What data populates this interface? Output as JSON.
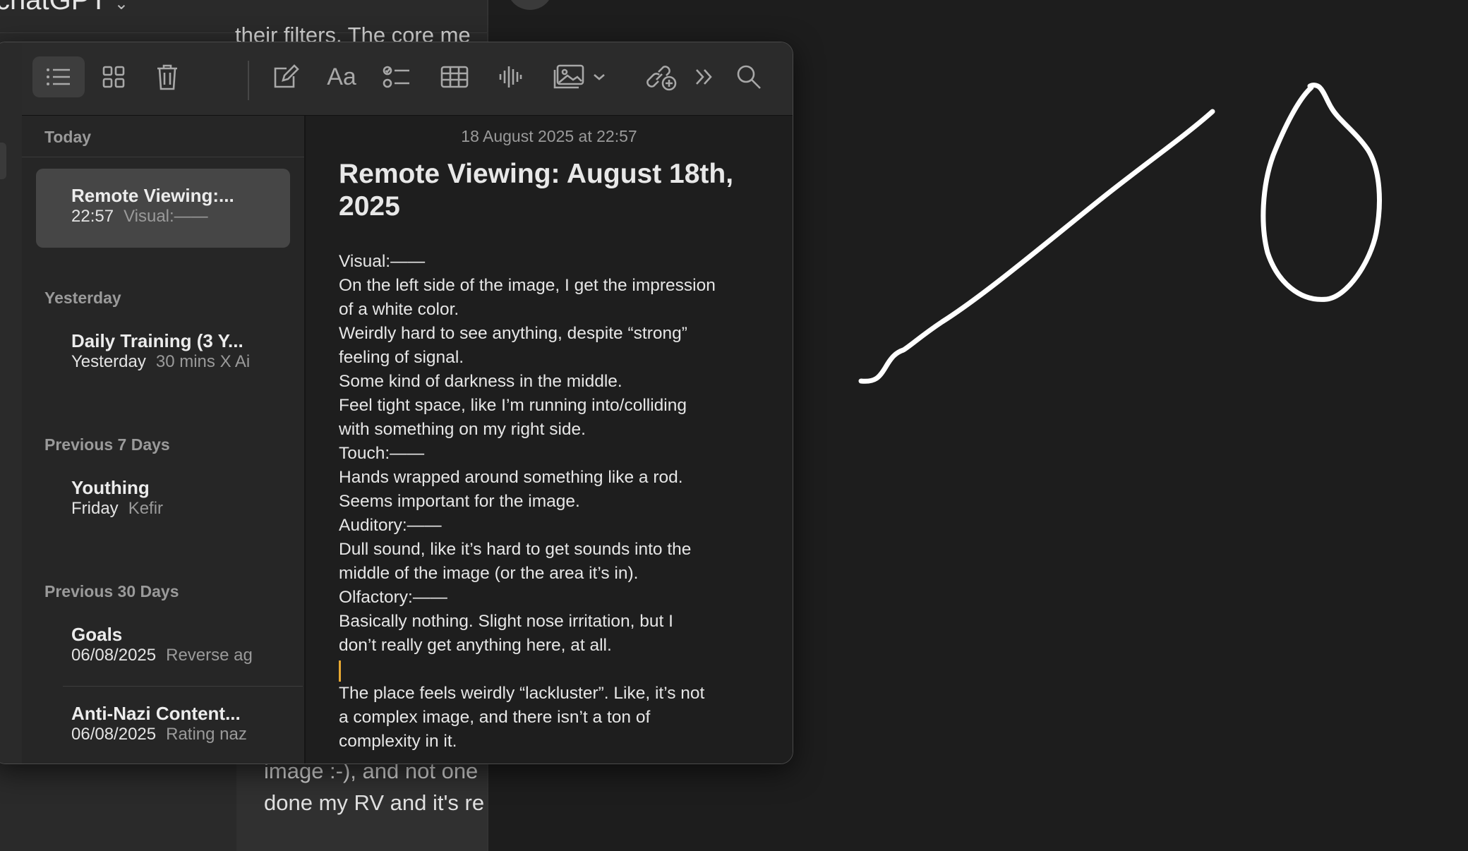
{
  "background_window": {
    "title": "chatGPT",
    "snippet_top": "their filters. The core me",
    "snippet_bottom_1": "image :-), and not one",
    "snippet_bottom_2": "done my RV and it's re"
  },
  "toolbar": {
    "icons": [
      "list-view-icon",
      "gallery-view-icon",
      "trash-icon",
      "compose-icon",
      "format-text-icon",
      "checklist-icon",
      "table-icon",
      "audio-icon",
      "media-icon",
      "chevron-down-icon",
      "collaborate-icon",
      "more-icon",
      "search-icon"
    ],
    "format_label": "Aa"
  },
  "sidebar": {
    "sections": [
      {
        "header": "Today",
        "notes": [
          {
            "title": "Remote Viewing:...",
            "time": "22:57",
            "preview": "Visual:——",
            "selected": true
          }
        ]
      },
      {
        "header": "Yesterday",
        "notes": [
          {
            "title": "Daily Training (3 Y...",
            "time": "Yesterday",
            "preview": "30 mins X Ai"
          }
        ]
      },
      {
        "header": "Previous 7 Days",
        "notes": [
          {
            "title": "Youthing",
            "time": "Friday",
            "preview": "Kefir"
          }
        ]
      },
      {
        "header": "Previous 30 Days",
        "notes": [
          {
            "title": "Goals",
            "time": "06/08/2025",
            "preview": "Reverse ag"
          },
          {
            "title": "Anti-Nazi Content...",
            "time": "06/08/2025",
            "preview": "Rating naz"
          }
        ]
      }
    ]
  },
  "editor": {
    "date": "18 August 2025 at 22:57",
    "title": "Remote Viewing: August 18th, 2025",
    "lines": [
      "Visual:——",
      "On the left side of the image, I get the impression",
      "of a white color.",
      "Weirdly hard to see anything, despite “strong”",
      "feeling of signal.",
      "Some kind of darkness in the middle.",
      "Feel tight space, like I’m running into/colliding",
      "with something on my right side.",
      "Touch:——",
      "Hands wrapped around something like a rod.",
      "Seems important for the image.",
      "Auditory:——",
      "Dull sound, like it’s hard to get sounds into the",
      "middle of the image (or the area it’s in).",
      "Olfactory:——",
      "Basically nothing. Slight nose irritation, but I",
      "don’t really get anything here, at all.",
      "",
      "The place feels weirdly “lackluster”. Like, it’s not",
      "a complex image, and there isn’t a ton of",
      "complexity in it."
    ]
  },
  "colors": {
    "caret": "#e7a832",
    "selected_row": "#464646",
    "background": "#1d1d1d"
  }
}
